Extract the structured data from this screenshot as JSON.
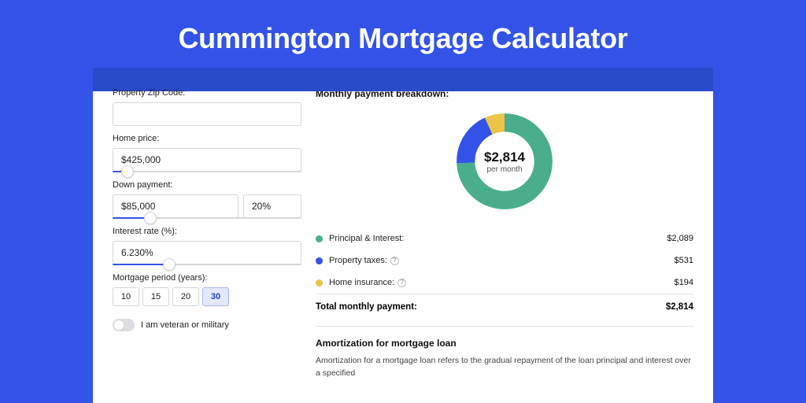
{
  "title": "Cummington Mortgage Calculator",
  "form": {
    "zip_label": "Property Zip Code:",
    "zip_value": "",
    "home_price_label": "Home price:",
    "home_price_value": "$425,000",
    "home_price_slider_pct": 8,
    "down_payment_label": "Down payment:",
    "down_payment_value": "$85,000",
    "down_payment_pct": "20%",
    "down_payment_slider_pct": 20,
    "interest_label": "Interest rate (%):",
    "interest_value": "6.230%",
    "interest_slider_pct": 30,
    "period_label": "Mortgage period (years):",
    "periods": [
      "10",
      "15",
      "20",
      "30"
    ],
    "period_active": "30",
    "veteran_label": "I am veteran or military"
  },
  "breakdown": {
    "title": "Monthly payment breakdown:",
    "donut_amount": "$2,814",
    "donut_sub": "per month",
    "items": [
      {
        "label": "Principal & Interest:",
        "value": "$2,089",
        "color": "#4aae8c",
        "info": false
      },
      {
        "label": "Property taxes:",
        "value": "$531",
        "color": "#3353e8",
        "info": true
      },
      {
        "label": "Home insurance:",
        "value": "$194",
        "color": "#ecc447",
        "info": true
      }
    ],
    "total_label": "Total monthly payment:",
    "total_value": "$2,814"
  },
  "chart_data": {
    "type": "pie",
    "title": "Monthly payment breakdown",
    "series": [
      {
        "name": "Principal & Interest",
        "value": 2089,
        "color": "#4aae8c"
      },
      {
        "name": "Property taxes",
        "value": 531,
        "color": "#3353e8"
      },
      {
        "name": "Home insurance",
        "value": 194,
        "color": "#ecc447"
      }
    ],
    "total": 2814,
    "center_label": "$2,814 per month"
  },
  "amortization": {
    "title": "Amortization for mortgage loan",
    "text": "Amortization for a mortgage loan refers to the gradual repayment of the loan principal and interest over a specified"
  }
}
